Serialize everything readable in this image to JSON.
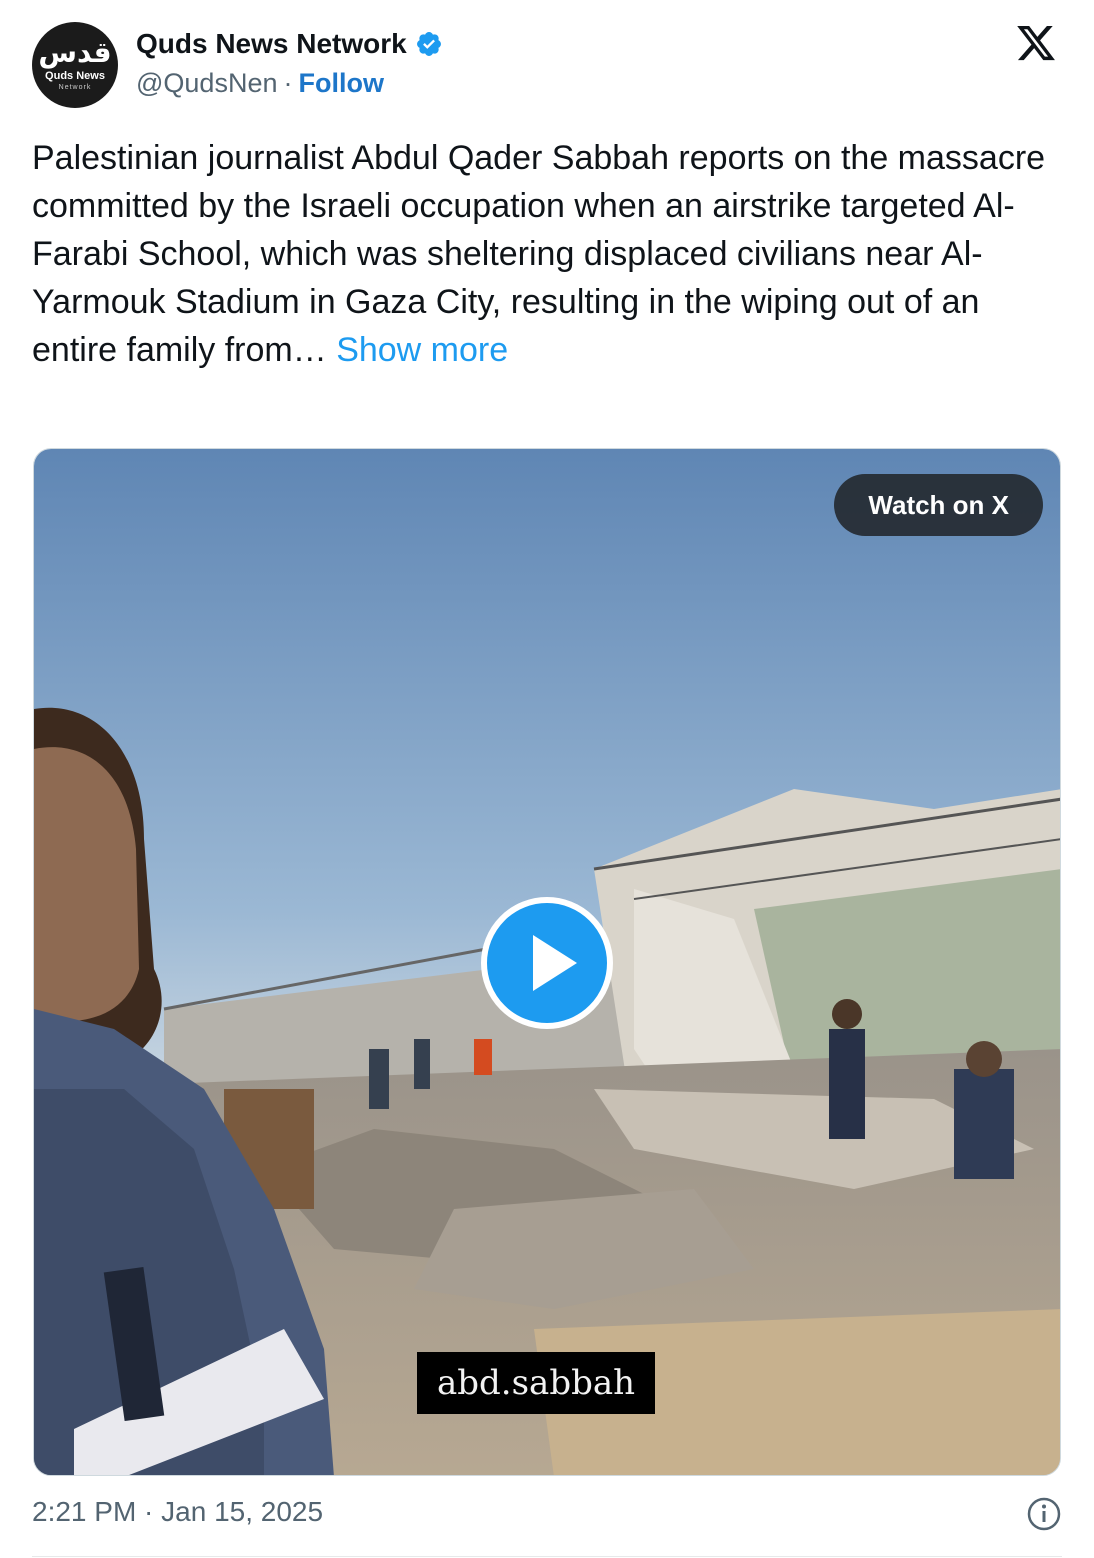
{
  "author": {
    "display_name": "Quds News Network",
    "handle": "@QudsNen",
    "separator": "·",
    "follow_label": "Follow",
    "avatar_logo_arabic": "قدس",
    "avatar_logo_english": "Quds News",
    "avatar_logo_sub": "Network"
  },
  "tweet": {
    "text": "Palestinian journalist Abdul Qader Sabbah reports on the massacre committed by the Israeli occupation when an airstrike targeted Al-Farabi School, which was sheltering displaced civilians near Al-Yarmouk Stadium in Gaza City, resulting in the wiping out of an entire family from…",
    "show_more": "Show more"
  },
  "media": {
    "watch_label": "Watch on X",
    "caption": "abd.sabbah"
  },
  "footer": {
    "timestamp": "2:21 PM · Jan 15, 2025"
  },
  "colors": {
    "link": "#1d9bf0",
    "follow": "#1d76c9",
    "verified": "#1d9bf0",
    "text": "#0f1419",
    "muted": "#536471"
  },
  "icons": {
    "platform": "x-logo-icon",
    "verified": "verified-badge-icon",
    "play": "play-icon",
    "info": "info-icon"
  }
}
